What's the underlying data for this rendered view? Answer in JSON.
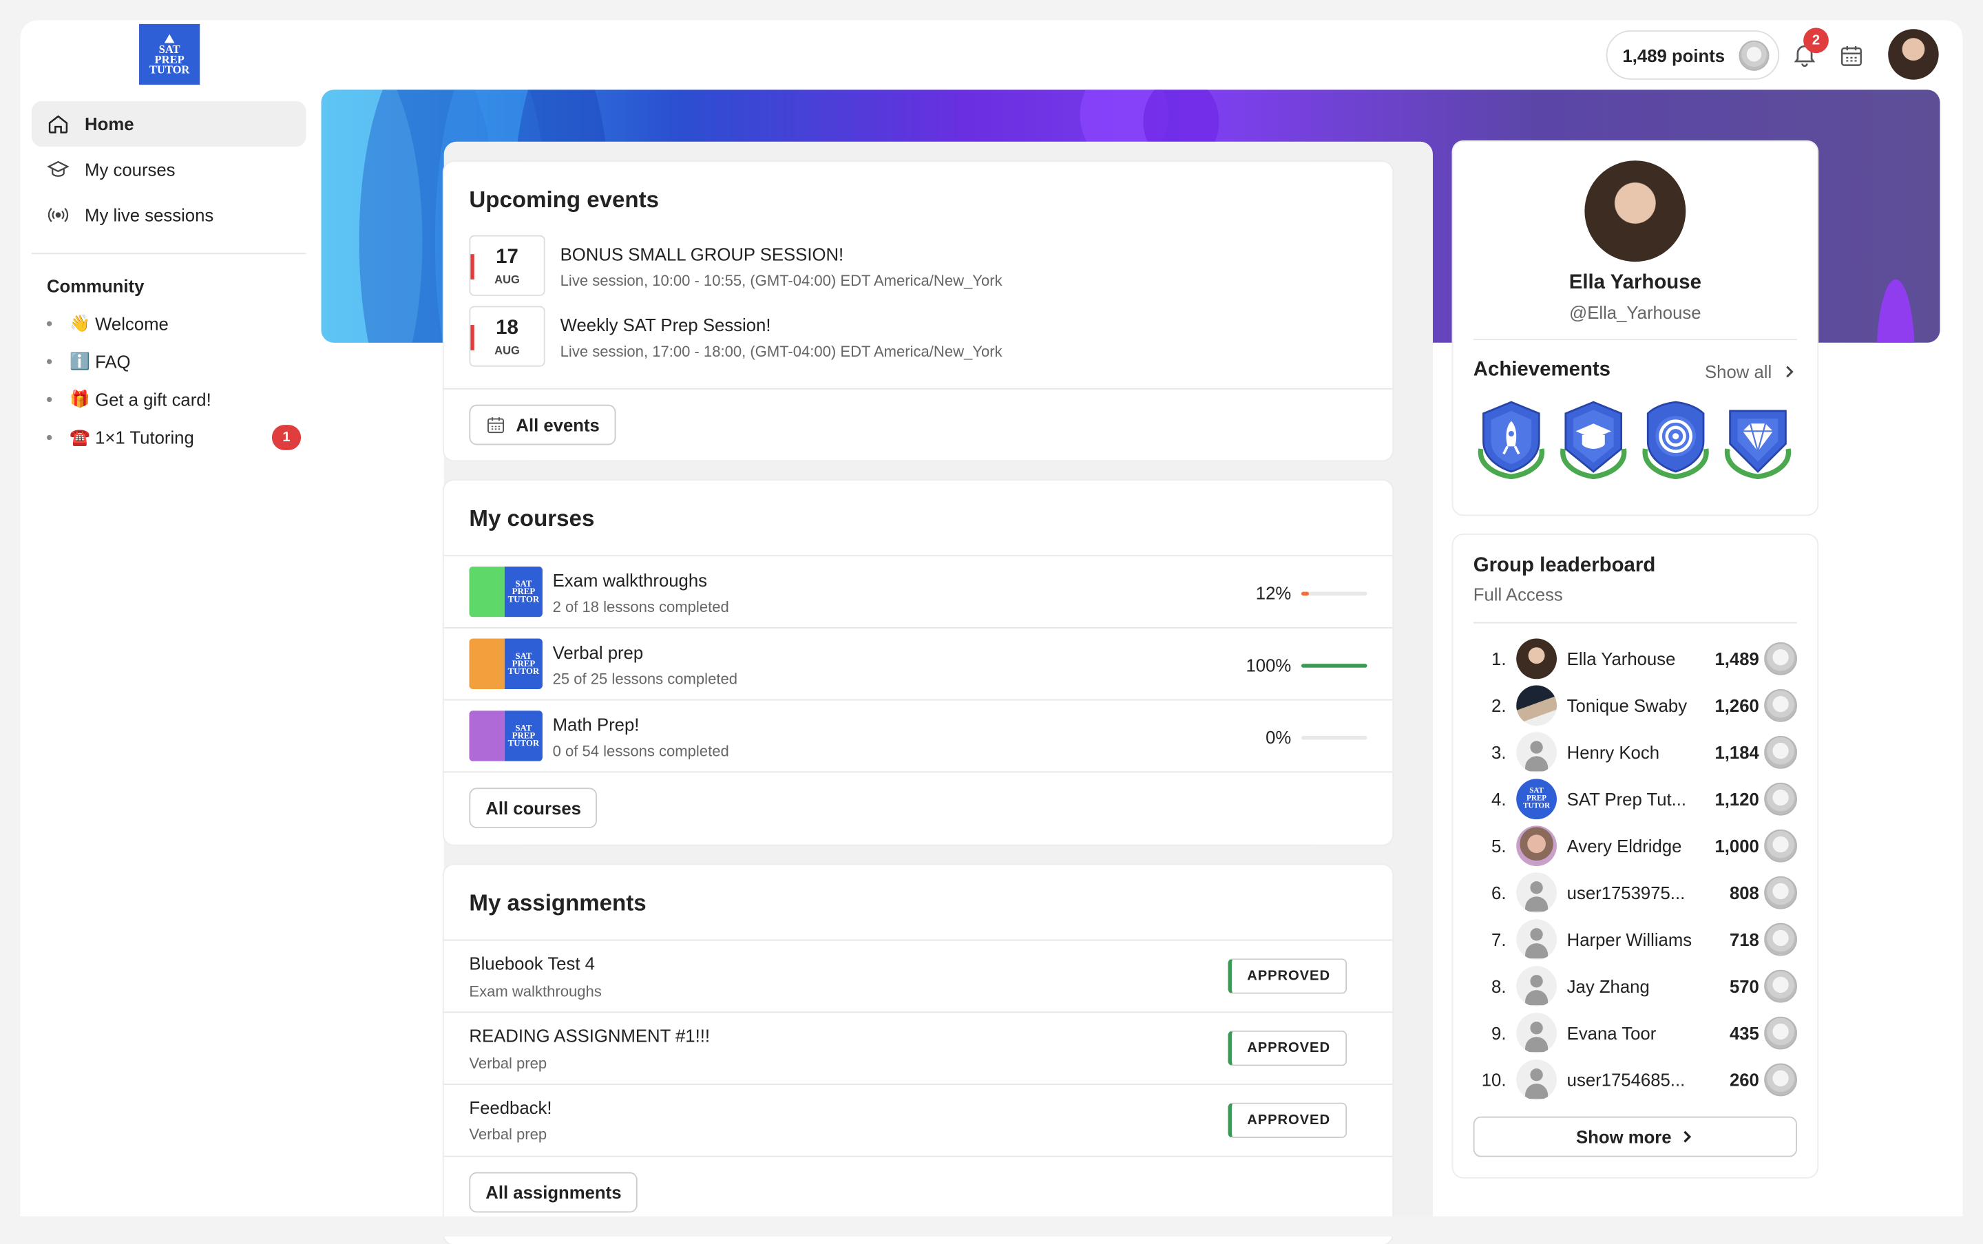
{
  "header": {
    "logo_text": [
      "SAT",
      "PREP",
      "TUTOR"
    ],
    "points_label": "1,489 points",
    "notifications_count": "2"
  },
  "sidebar": {
    "items": [
      {
        "label": "Home",
        "icon": "home-icon",
        "active": true
      },
      {
        "label": "My courses",
        "icon": "graduation-cap-icon",
        "active": false
      },
      {
        "label": "My live sessions",
        "icon": "broadcast-icon",
        "active": false
      }
    ],
    "community_title": "Community",
    "community_items": [
      {
        "label": "Welcome",
        "emoji": "👋",
        "badge": ""
      },
      {
        "label": "FAQ",
        "emoji": "ℹ️",
        "badge": ""
      },
      {
        "label": "Get a gift card!",
        "emoji": "🎁",
        "badge": ""
      },
      {
        "label": "1×1 Tutoring",
        "emoji": "☎️",
        "badge": "1"
      }
    ]
  },
  "events": {
    "title": "Upcoming events",
    "items": [
      {
        "day": "17",
        "month": "AUG",
        "title": "BONUS SMALL GROUP SESSION!",
        "subtitle": "Live session, 10:00 - 10:55, (GMT-04:00) EDT America/New_York"
      },
      {
        "day": "18",
        "month": "AUG",
        "title": "Weekly SAT Prep Session!",
        "subtitle": "Live session, 17:00 - 18:00, (GMT-04:00) EDT America/New_York"
      }
    ],
    "button_label": "All events"
  },
  "courses": {
    "title": "My courses",
    "items": [
      {
        "title": "Exam walkthroughs",
        "subtitle": "2 of 18 lessons completed",
        "percent_label": "12%",
        "progress": 0.12,
        "bar_color": "#f26d3d",
        "thumb_color": "#5fd86a"
      },
      {
        "title": "Verbal prep",
        "subtitle": "25 of 25 lessons completed",
        "percent_label": "100%",
        "progress": 1.0,
        "bar_color": "#3a9a55",
        "thumb_color": "#f2a03d"
      },
      {
        "title": "Math Prep!",
        "subtitle": "0 of 54 lessons completed",
        "percent_label": "0%",
        "progress": 0.0,
        "bar_color": "#3a9a55",
        "thumb_color": "#b06ad8"
      }
    ],
    "button_label": "All courses"
  },
  "assignments": {
    "title": "My assignments",
    "items": [
      {
        "title": "Bluebook Test 4",
        "subtitle": "Exam walkthroughs",
        "status": "APPROVED"
      },
      {
        "title": "READING ASSIGNMENT #1!!!",
        "subtitle": "Verbal prep",
        "status": "APPROVED"
      },
      {
        "title": "Feedback!",
        "subtitle": "Verbal prep",
        "status": "APPROVED"
      }
    ],
    "button_label": "All assignments"
  },
  "profile": {
    "name": "Ella Yarhouse",
    "handle": "@Ella_Yarhouse",
    "achievements_title": "Achievements",
    "show_all_label": "Show all",
    "achievement_icons": [
      "rocket-badge-icon",
      "graduation-badge-icon",
      "target-badge-icon",
      "diamond-badge-icon"
    ]
  },
  "leaderboard": {
    "title": "Group leaderboard",
    "subtitle": "Full Access",
    "rows": [
      {
        "rank": "1.",
        "name": "Ella Yarhouse",
        "points": "1,489",
        "avatar": "photo-woman"
      },
      {
        "rank": "2.",
        "name": "Tonique Swaby",
        "points": "1,260",
        "avatar": "photo-hat"
      },
      {
        "rank": "3.",
        "name": "Henry Koch",
        "points": "1,184",
        "avatar": "generic"
      },
      {
        "rank": "4.",
        "name": "SAT Prep Tut...",
        "points": "1,120",
        "avatar": "logo"
      },
      {
        "rank": "5.",
        "name": "Avery Eldridge",
        "points": "1,000",
        "avatar": "photo-man"
      },
      {
        "rank": "6.",
        "name": "user1753975...",
        "points": "808",
        "avatar": "generic"
      },
      {
        "rank": "7.",
        "name": "Harper Williams",
        "points": "718",
        "avatar": "generic"
      },
      {
        "rank": "8.",
        "name": "Jay Zhang",
        "points": "570",
        "avatar": "generic"
      },
      {
        "rank": "9.",
        "name": "Evana Toor",
        "points": "435",
        "avatar": "generic"
      },
      {
        "rank": "10.",
        "name": "user1754685...",
        "points": "260",
        "avatar": "generic"
      }
    ],
    "show_more_label": "Show more"
  }
}
